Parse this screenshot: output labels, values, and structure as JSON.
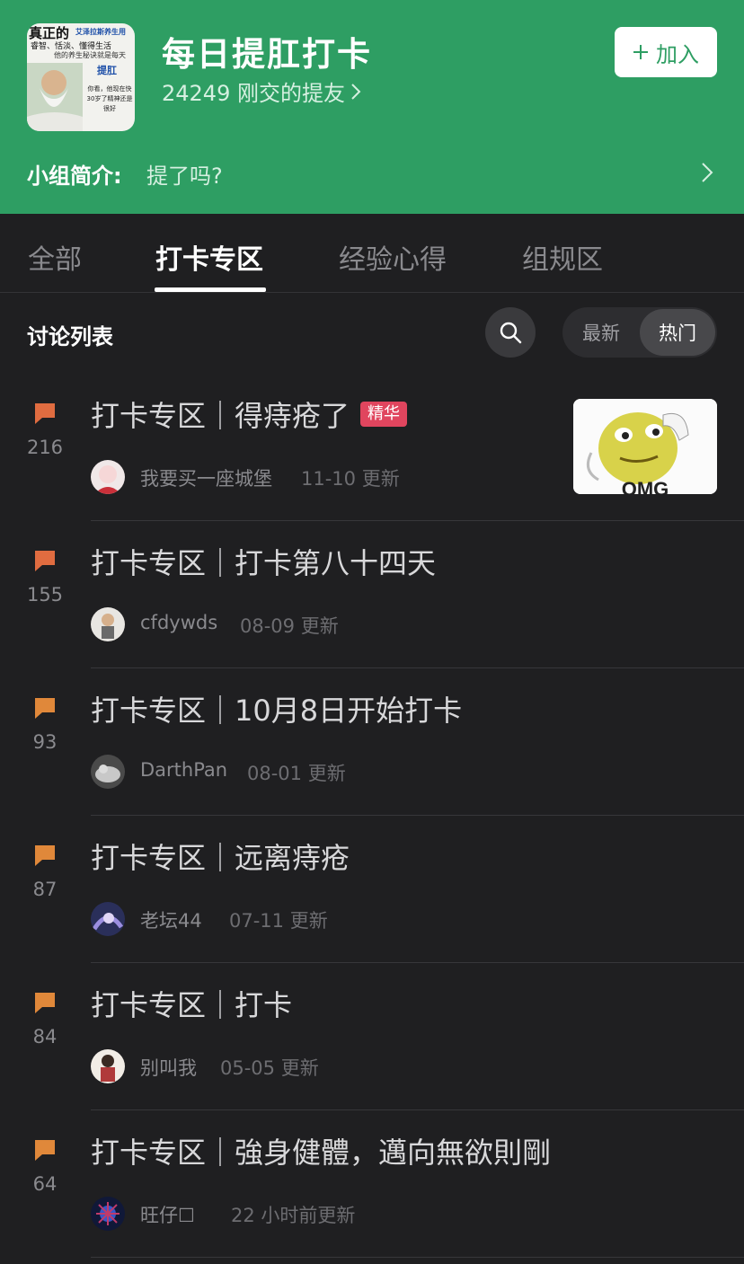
{
  "group": {
    "title": "每日提肛打卡",
    "members_text": "24249 刚交的提友",
    "join_label": "加入",
    "intro_label": "小组简介:",
    "intro_text": "提了吗?",
    "avatar_lines": {
      "l1": "真正的",
      "l2": "艾泽拉斯养生用",
      "l3": "睿智、恬淡、懂得生活",
      "l4": "他的养生秘诀就是每天",
      "l5": "提肛",
      "l6": "你看，他现在快30岁了精神还是很好"
    }
  },
  "tabs": [
    {
      "label": "全部"
    },
    {
      "label": "打卡专区"
    },
    {
      "label": "经验心得"
    },
    {
      "label": "组规区"
    }
  ],
  "list": {
    "title": "讨论列表",
    "sort_latest": "最新",
    "sort_hot": "热门"
  },
  "colors": {
    "brand_green": "#2e9e63",
    "badge_red": "#e0455e",
    "comment_icon_orange": "#e06c40",
    "comment_icon_amber": "#e0883a"
  },
  "posts": [
    {
      "count": "216",
      "title": "打卡专区｜得痔疮了",
      "badge": "精华",
      "author": "我要买一座城堡",
      "updated": "11-10 更新",
      "thumb_text": "OMG"
    },
    {
      "count": "155",
      "title": "打卡专区｜打卡第八十四天",
      "author": "cfdywds",
      "updated": "08-09 更新"
    },
    {
      "count": "93",
      "title": "打卡专区｜10月8日开始打卡",
      "author": "DarthPan",
      "updated": "08-01 更新"
    },
    {
      "count": "87",
      "title": "打卡专区｜远离痔疮",
      "author": "老坛44",
      "updated": "07-11 更新"
    },
    {
      "count": "84",
      "title": "打卡专区｜打卡",
      "author": "别叫我",
      "updated": "05-05 更新"
    },
    {
      "count": "64",
      "title": "打卡专区｜強身健體，邁向無欲則剛",
      "author": "旺仔☐",
      "updated": "22 小时前更新"
    }
  ]
}
